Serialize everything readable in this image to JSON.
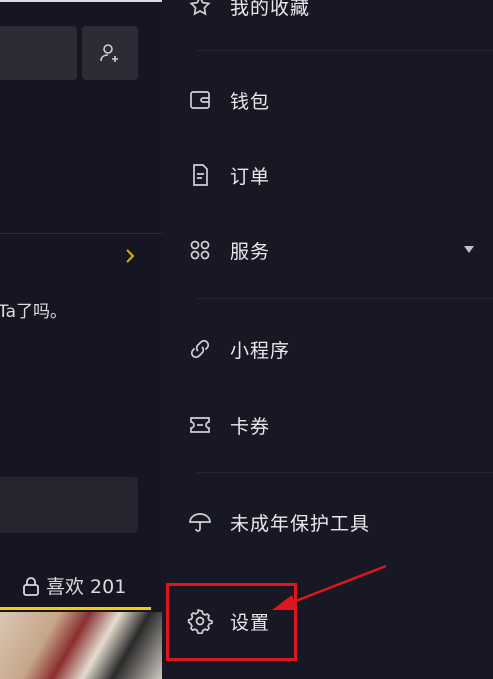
{
  "background": {
    "partial_text": "Ta了吗。",
    "likes_tab_label": "喜欢 201"
  },
  "drawer": {
    "items": [
      {
        "label": "我的收藏",
        "icon": "star-icon"
      },
      {
        "label": "钱包",
        "icon": "wallet-icon"
      },
      {
        "label": "订单",
        "icon": "order-icon"
      },
      {
        "label": "服务",
        "icon": "grid-icon"
      },
      {
        "label": "小程序",
        "icon": "mini-program-icon"
      },
      {
        "label": "卡券",
        "icon": "coupon-icon"
      },
      {
        "label": "未成年保护工具",
        "icon": "umbrella-icon"
      },
      {
        "label": "设置",
        "icon": "gear-icon"
      }
    ]
  },
  "colors": {
    "background": "#171823",
    "highlight": "#e0161e",
    "accent": "#f0d000"
  }
}
